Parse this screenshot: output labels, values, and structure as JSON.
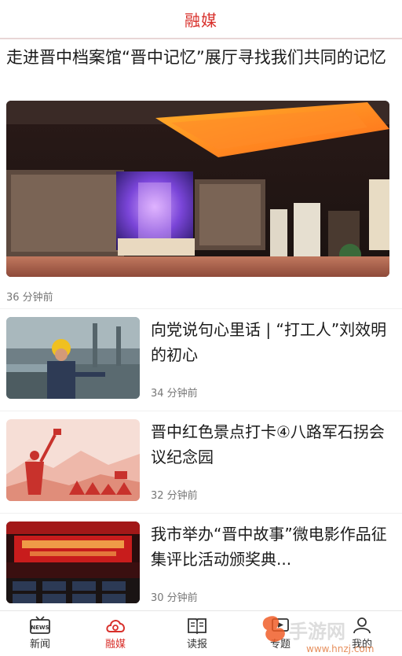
{
  "header": {
    "title": "融媒"
  },
  "feature": {
    "title": "走进晋中档案馆“晋中记忆”展厅寻找我们共同的记忆",
    "time": "36 分钟前"
  },
  "articles": [
    {
      "title": "向党说句心里话 | “打工人”刘效明的初心",
      "time": "34 分钟前"
    },
    {
      "title": "晋中红色景点打卡④八路军石拐会议纪念园",
      "time": "32 分钟前"
    },
    {
      "title": "我市举办“晋中故事”微电影作品征集评比活动颁奖典...",
      "time": "30 分钟前"
    }
  ],
  "tabbar": {
    "items": [
      {
        "label": "新闻",
        "icon": "news-icon",
        "active": false
      },
      {
        "label": "融媒",
        "icon": "media-cloud-icon",
        "active": true
      },
      {
        "label": "读报",
        "icon": "newspaper-book-icon",
        "active": false
      },
      {
        "label": "专题",
        "icon": "topic-icon",
        "active": false
      },
      {
        "label": "我的",
        "icon": "profile-icon",
        "active": false
      }
    ]
  },
  "watermark": {
    "brand": "火鸟手游网",
    "url": "www.hnzj.com"
  },
  "colors": {
    "accent": "#d8302b",
    "muted": "#777777",
    "divider": "#e8d6d6"
  }
}
